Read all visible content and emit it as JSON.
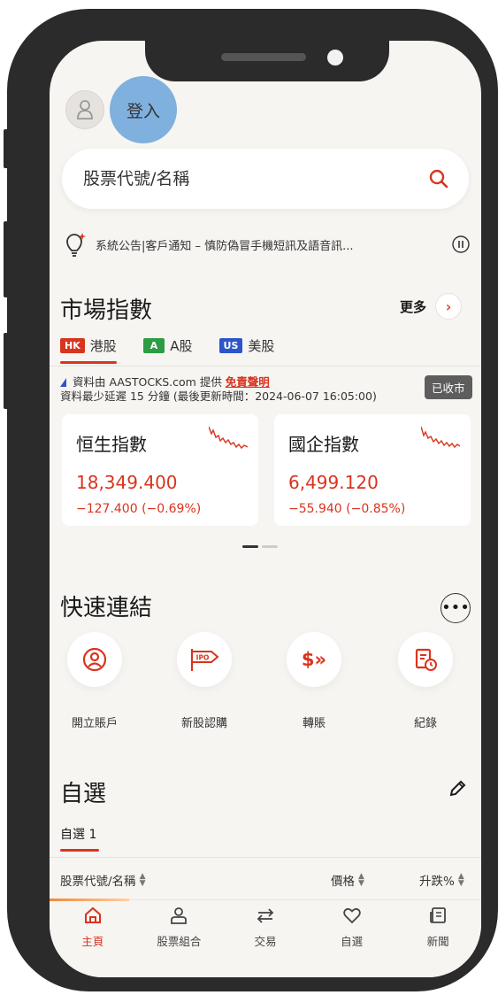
{
  "header": {
    "login_label": "登入"
  },
  "search": {
    "placeholder": "股票代號/名稱"
  },
  "notice": {
    "text": "系統公告|客戶通知 – 慎防偽冒手機短訊及語音訊..."
  },
  "market": {
    "title": "市場指數",
    "more_label": "更多",
    "tabs": [
      {
        "badge": "HK",
        "label": "港股",
        "badge_color": "#d9341e"
      },
      {
        "badge": "A",
        "label": "A股",
        "badge_color": "#2e9b45"
      },
      {
        "badge": "US",
        "label": "美股",
        "badge_color": "#2c56c8"
      }
    ],
    "source_prefix": "資料由 AASTOCKS.com 提供 ",
    "disclaimer_link": "免責聲明",
    "delay_note": "資料最少延遲 15 分鐘 (最後更新時間：2024-06-07 16:05:00)",
    "status": "已收市",
    "indices": [
      {
        "name": "恒生指數",
        "value": "18,349.400",
        "change": "−127.400 (−0.69%)"
      },
      {
        "name": "國企指數",
        "value": "6,499.120",
        "change": "−55.940 (−0.85%)"
      }
    ]
  },
  "quick_links": {
    "title": "快速連結",
    "items": [
      {
        "label": "開立賬戶",
        "icon": "user-circle-icon"
      },
      {
        "label": "新股認購",
        "icon": "ipo-flag-icon"
      },
      {
        "label": "轉賬",
        "icon": "transfer-dollar-icon"
      },
      {
        "label": "紀錄",
        "icon": "record-clock-icon"
      }
    ],
    "ipo_badge": "IPO",
    "transfer_glyph": "$»"
  },
  "watchlist": {
    "title": "自選",
    "tab": "自選 1",
    "col_code": "股票代號/名稱",
    "col_price": "價格",
    "col_change": "升跌%"
  },
  "bottom_nav": {
    "items": [
      {
        "label": "主頁",
        "icon": "home-icon"
      },
      {
        "label": "股票組合",
        "icon": "portfolio-icon"
      },
      {
        "label": "交易",
        "icon": "trade-icon"
      },
      {
        "label": "自選",
        "icon": "heart-icon"
      },
      {
        "label": "新聞",
        "icon": "news-icon"
      }
    ]
  },
  "colors": {
    "accent": "#d9341e",
    "login_highlight": "#7fb0de",
    "pager_active": "#333333",
    "pager_inactive": "#cccccc"
  }
}
